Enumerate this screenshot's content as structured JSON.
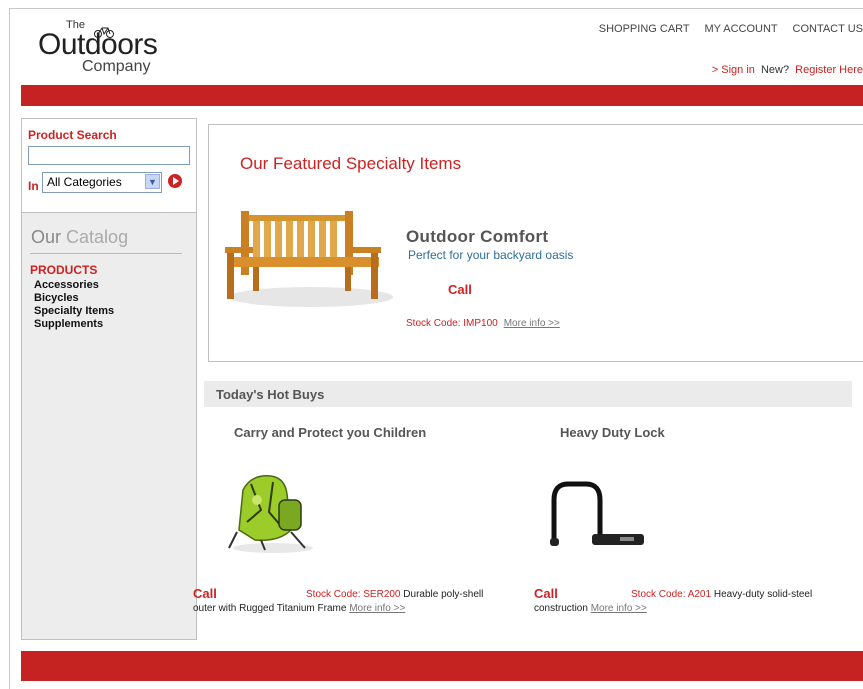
{
  "header": {
    "logo_the": "The",
    "logo_brand": "Outdoors",
    "logo_company": "Company",
    "nav": [
      "SHOPPING CART",
      "MY ACCOUNT",
      "CONTACT US"
    ],
    "sign_in": "> Sign in",
    "new_label": "New?",
    "register": "Register Here"
  },
  "sidebar": {
    "search_title": "Product Search",
    "search_value": "",
    "in_label": "In",
    "category_selected": "All Categories",
    "catalog_title_a": "Our",
    "catalog_title_b": "Catalog",
    "products_head": "PRODUCTS",
    "categories": [
      "Accessories",
      "Bicycles",
      "Specialty Items",
      "Supplements"
    ]
  },
  "featured": {
    "section_title": "Our Featured Specialty Items",
    "name": "Outdoor Comfort",
    "subtitle": "Perfect for your backyard oasis",
    "price": "Call",
    "stock_code": "Stock Code: IMP100",
    "more_info": "More info >>"
  },
  "hot_buys": {
    "title": "Today's Hot Buys",
    "items": [
      {
        "name": "Carry and Protect you Children",
        "price": "Call",
        "stock_code": "Stock Code: SER200",
        "desc_a": "Durable poly-shell",
        "desc_b": "outer with Rugged Titanium Frame",
        "more_info": "More info >>"
      },
      {
        "name": "Heavy Duty Lock",
        "price": "Call",
        "stock_code": "Stock Code: A201",
        "desc_a": "Heavy-duty solid-steel",
        "desc_b": "construction",
        "more_info": "More info >>"
      }
    ]
  },
  "colors": {
    "accent_red": "#c52222",
    "text_red": "#cc2222",
    "link_blue": "#2e6f9e"
  }
}
